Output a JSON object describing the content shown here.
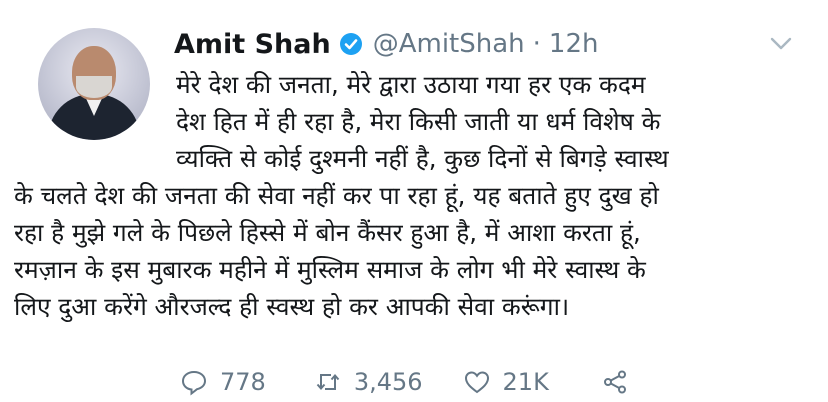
{
  "tweet": {
    "author_name": "Amit Shah",
    "handle": "@AmitShah",
    "separator": "·",
    "time": "12h",
    "lines": [
      "मेरे देश की जनता, मेरे द्वारा उठाया गया हर एक कदम",
      "देश हित में ही रहा है, मेरा किसी जाती या धर्म विशेष के",
      "व्यक्ति से कोई दुश्मनी नहीं है, कुछ दिनों से बिगड़े स्वास्थ",
      "के चलते देश की जनता की सेवा नहीं कर पा रहा हूं, यह बताते हुए दुख हो",
      "रहा है मुझे गले के पिछले हिस्से में बोन कैंसर हुआ है, में आशा करता हूं,",
      "रमज़ान के इस मुबारक महीने में मुस्लिम समाज के लोग भी मेरे स्वास्थ के",
      "लिए दुआ करेंगे औरजल्द ही स्वस्थ हो कर आपकी सेवा करूंगा।"
    ],
    "replies": "778",
    "retweets": "3,456",
    "likes": "21K"
  },
  "icons": {
    "verified": "verified-badge-icon",
    "menu": "chevron-down-icon",
    "reply": "reply-icon",
    "retweet": "retweet-icon",
    "like": "heart-icon",
    "share": "share-icon"
  },
  "colors": {
    "text": "#14171a",
    "secondary": "#657786",
    "verified": "#1da1f2"
  }
}
